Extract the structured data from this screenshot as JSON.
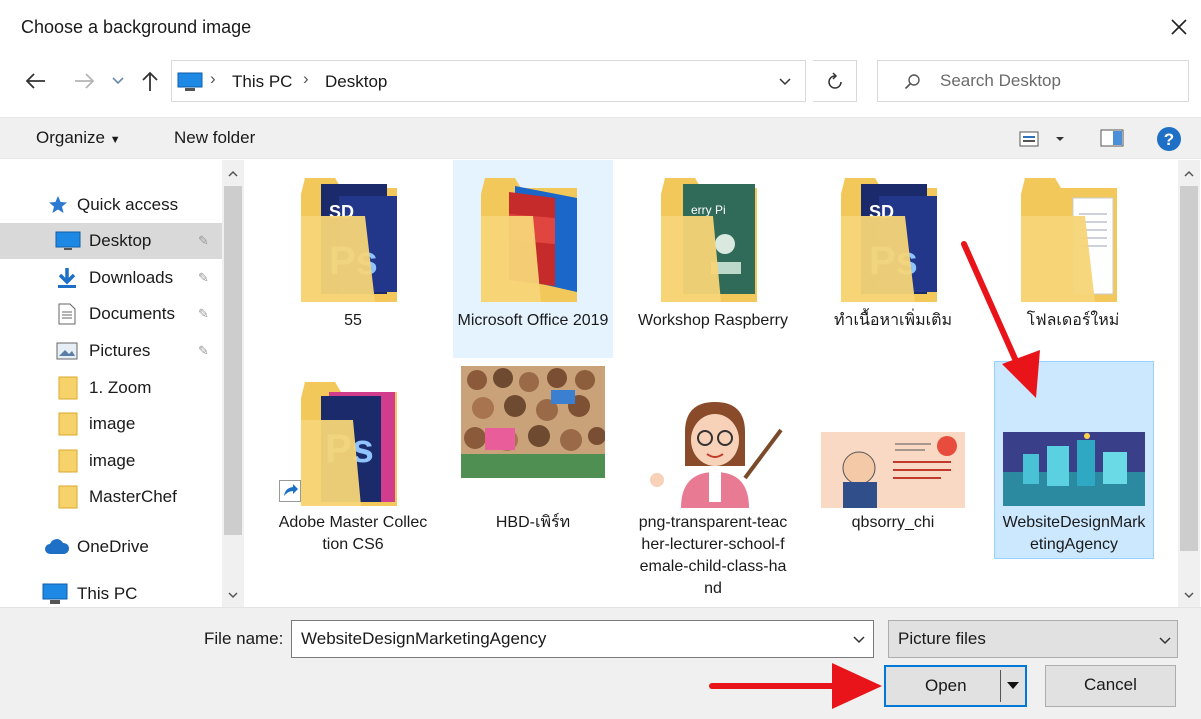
{
  "window": {
    "title": "Choose a background image"
  },
  "address": {
    "segments": [
      "This PC",
      "Desktop"
    ],
    "search_placeholder": "Search Desktop"
  },
  "toolbar": {
    "organize_label": "Organize",
    "new_folder_label": "New folder"
  },
  "sidebar": {
    "items": [
      {
        "label": "Quick access",
        "icon": "star-icon"
      },
      {
        "label": "Desktop",
        "icon": "desktop-icon",
        "pinned": true,
        "selected": true
      },
      {
        "label": "Downloads",
        "icon": "download-icon",
        "pinned": true
      },
      {
        "label": "Documents",
        "icon": "document-icon",
        "pinned": true
      },
      {
        "label": "Pictures",
        "icon": "pictures-icon",
        "pinned": true
      },
      {
        "label": "1. Zoom",
        "icon": "folder-icon"
      },
      {
        "label": "image",
        "icon": "folder-icon"
      },
      {
        "label": "image",
        "icon": "folder-icon"
      },
      {
        "label": "MasterChef",
        "icon": "folder-icon"
      },
      {
        "label": "OneDrive",
        "icon": "cloud-icon"
      },
      {
        "label": "This PC",
        "icon": "computer-icon"
      }
    ]
  },
  "files": [
    {
      "label": "55",
      "kind": "folder-ps"
    },
    {
      "label": "Microsoft Office 2019",
      "kind": "folder-office"
    },
    {
      "label": "Workshop Raspberry",
      "kind": "folder-green"
    },
    {
      "label": "ทำเนื้อหาเพิ่มเติม",
      "kind": "folder-ps"
    },
    {
      "label": "โฟลเดอร์ใหม่",
      "kind": "folder-doc"
    },
    {
      "label": "Adobe Master Collection CS6",
      "kind": "shortcut-ps"
    },
    {
      "label": "HBD-เพิร์ท",
      "kind": "photo-kids"
    },
    {
      "label": "png-transparent-teacher-lecturer-school-female-child-class-hand",
      "kind": "photo-teacher"
    },
    {
      "label": "qbsorry_chi",
      "kind": "photo-sorry"
    },
    {
      "label": "WebsiteDesignMarketingAgency",
      "kind": "photo-web"
    }
  ],
  "footer": {
    "filename_label": "File name:",
    "filename_value": "WebsiteDesignMarketingAgency",
    "filter_value": "Picture files",
    "open_label": "Open",
    "cancel_label": "Cancel"
  },
  "colors": {
    "accent": "#0078d7",
    "selection": "#cce8ff",
    "annotation_arrow": "#e8141a",
    "help": "#1e6fc6"
  }
}
